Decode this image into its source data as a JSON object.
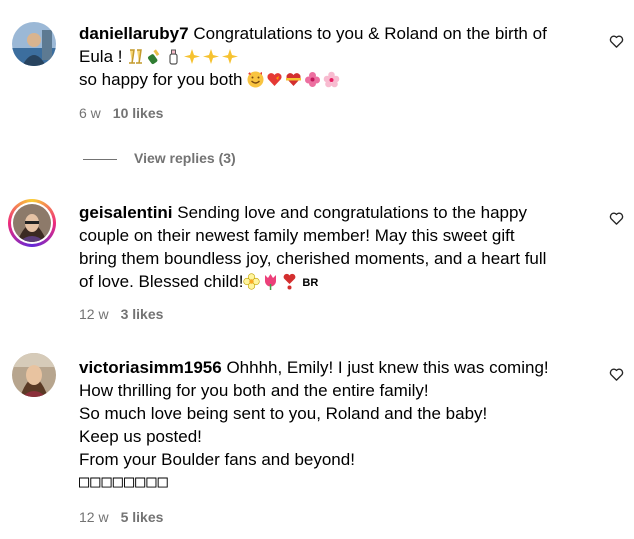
{
  "comments": [
    {
      "username": "daniellaruby7",
      "lines": [
        "Congratulations to you & Roland on the birth of",
        "Eula !",
        "so happy for you both"
      ],
      "time": "6 w",
      "likes": "10 likes",
      "emoji_line2": [
        "clinking-glasses",
        "champagne-bottle",
        "baby-bottle",
        "sparkles",
        "sparkles",
        "sparkles"
      ],
      "emoji_line3": [
        "smiling-hearts-face",
        "heart-on-fire",
        "red-heart-ribbon",
        "hibiscus",
        "cherry-blossom"
      ]
    },
    {
      "username": "geisalentini",
      "lines": [
        "Sending love and congratulations to the happy",
        "couple on their newest family member! May this sweet gift",
        "bring them boundless joy, cherished moments, and a heart full",
        "of love. Blessed child!"
      ],
      "tag": "BR",
      "time": "12 w",
      "likes": "3 likes",
      "emoji_line4": [
        "blossom",
        "tulip",
        "heart-exclamation"
      ]
    },
    {
      "username": "victoriasimm1956",
      "lines": [
        "Ohhhh, Emily! I just knew this was coming!",
        "How thrilling for you both and the entire family!",
        "So much love being sent to you, Roland and the baby!",
        "Keep us posted!",
        "From your Boulder fans and beyond!",
        "□□□□□□□□"
      ],
      "time": "12 w",
      "likes": "5 likes"
    }
  ],
  "view_replies": "View replies (3)",
  "colors": {
    "meta_text": "#737373",
    "story_ring": [
      "#f9ce34",
      "#ee2a7b",
      "#6228d7"
    ]
  }
}
